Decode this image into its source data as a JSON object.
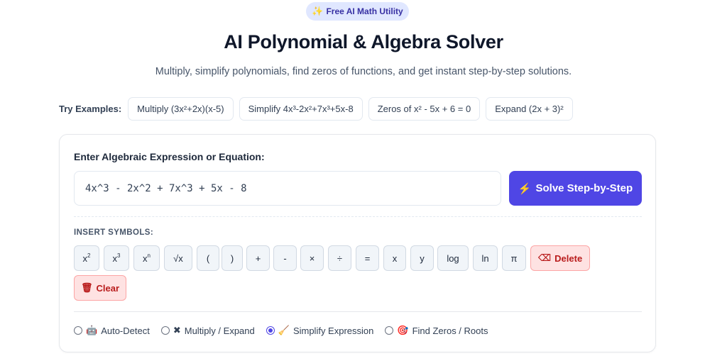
{
  "badge": {
    "icon": "✨",
    "text": "Free AI Math Utility"
  },
  "title": "AI Polynomial & Algebra Solver",
  "subtitle": "Multiply, simplify polynomials, find zeros of functions, and get instant step-by-step solutions.",
  "examples": {
    "label": "Try Examples:",
    "items": [
      "Multiply (3x²+2x)(x-5)",
      "Simplify 4x³-2x²+7x³+5x-8",
      "Zeros of x² - 5x + 6 = 0",
      "Expand (2x + 3)²"
    ]
  },
  "input": {
    "label": "Enter Algebraic Expression or Equation:",
    "value": "4x^3 - 2x^2 + 7x^3 + 5x - 8"
  },
  "solve_button": {
    "icon": "⚡",
    "label": "Solve Step-by-Step"
  },
  "symbols": {
    "label": "INSERT SYMBOLS:",
    "keys": {
      "x2": {
        "base": "x",
        "sup": "2"
      },
      "x3": {
        "base": "x",
        "sup": "3"
      },
      "xn": {
        "base": "x",
        "sup": "n"
      },
      "sqrt": "√x",
      "lparen": "(",
      "rparen": ")",
      "plus": "+",
      "minus": "-",
      "times": "×",
      "divide": "÷",
      "equals": "=",
      "x": "x",
      "y": "y",
      "log": "log",
      "ln": "ln",
      "pi": "π"
    },
    "delete": {
      "icon": "⌫",
      "label": "Delete"
    },
    "clear": {
      "icon": "🗑",
      "label": "Clear"
    }
  },
  "modes": [
    {
      "icon": "🤖",
      "label": "Auto-Detect",
      "selected": false
    },
    {
      "icon": "✖",
      "label": "Multiply / Expand",
      "selected": false
    },
    {
      "icon": "🧹",
      "label": "Simplify Expression",
      "selected": true
    },
    {
      "icon": "🎯",
      "label": "Find Zeros / Roots",
      "selected": false
    }
  ],
  "colors": {
    "accent": "#4f46e5",
    "danger_bg": "#fee2e2",
    "danger_text": "#b91c1c",
    "badge_bg": "#e0e7ff"
  }
}
